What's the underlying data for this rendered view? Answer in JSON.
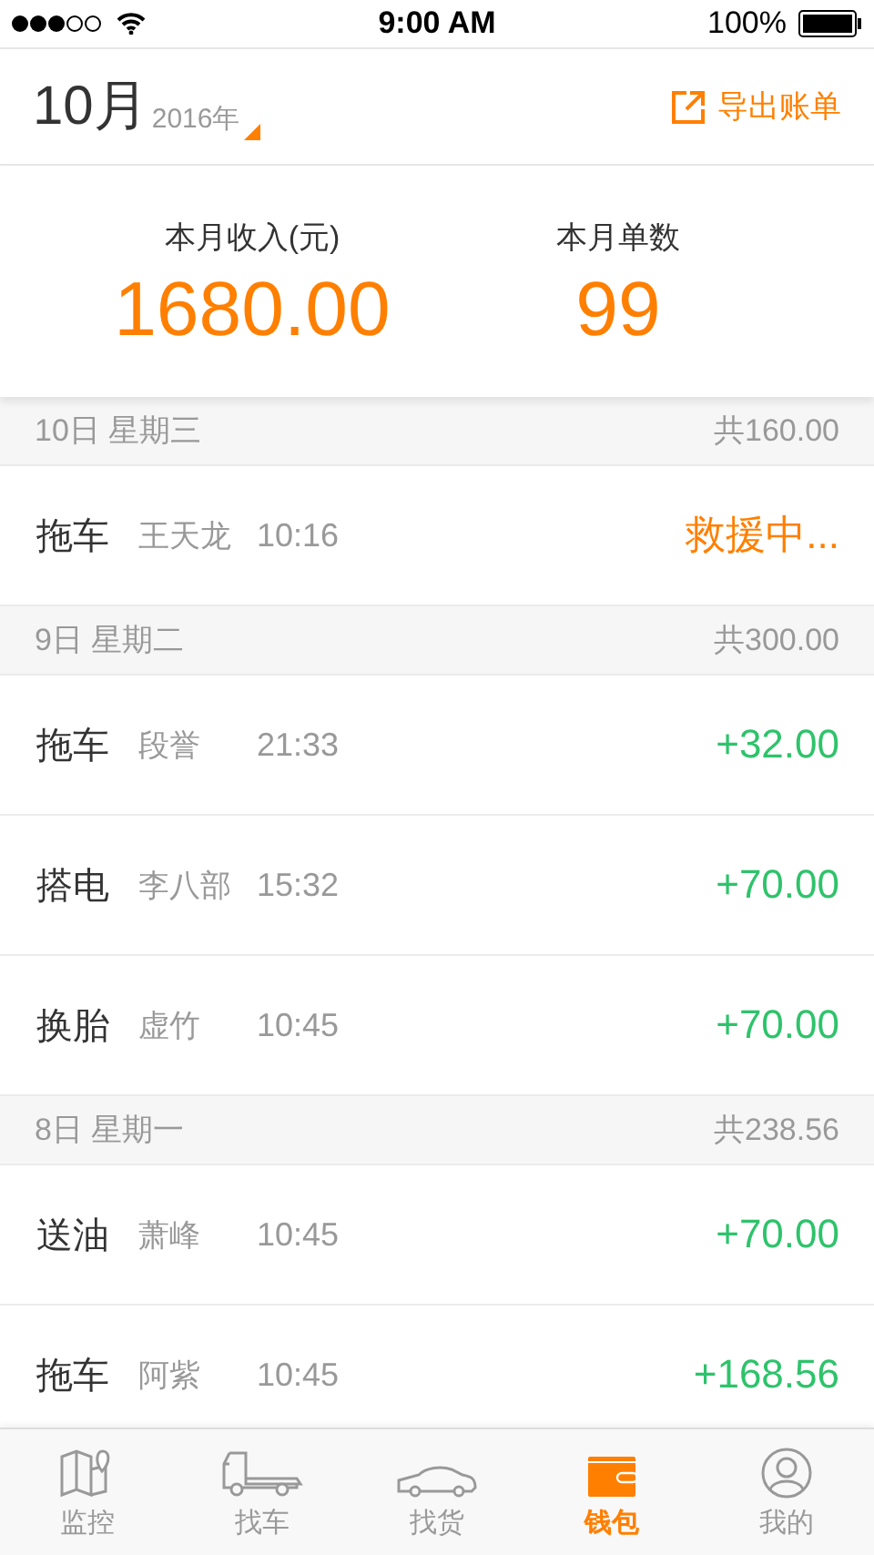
{
  "status_bar": {
    "time": "9:00 AM",
    "battery": "100%"
  },
  "header": {
    "month": "10月",
    "year": "2016年",
    "export": "导出账单"
  },
  "summary": [
    {
      "label": "本月收入(元)",
      "value": "1680.00"
    },
    {
      "label": "本月单数",
      "value": "99"
    }
  ],
  "days": [
    {
      "date": "10日 星期三",
      "total": "共160.00",
      "orders": [
        {
          "service": "拖车",
          "customer": "王天龙",
          "time": "10:16",
          "amount": "救援中...",
          "kind": "pending"
        }
      ]
    },
    {
      "date": "9日 星期二",
      "total": "共300.00",
      "orders": [
        {
          "service": "拖车",
          "customer": "段誉",
          "time": "21:33",
          "amount": "+32.00",
          "kind": "income"
        },
        {
          "service": "搭电",
          "customer": "李八部",
          "time": "15:32",
          "amount": "+70.00",
          "kind": "income"
        },
        {
          "service": "换胎",
          "customer": "虚竹",
          "time": "10:45",
          "amount": "+70.00",
          "kind": "income"
        }
      ]
    },
    {
      "date": "8日 星期一",
      "total": "共238.56",
      "orders": [
        {
          "service": "送油",
          "customer": "萧峰",
          "time": "10:45",
          "amount": "+70.00",
          "kind": "income"
        },
        {
          "service": "拖车",
          "customer": "阿紫",
          "time": "10:45",
          "amount": "+168.56",
          "kind": "income"
        }
      ]
    }
  ],
  "tabs": [
    {
      "label": "监控",
      "kind": "map",
      "selected": false
    },
    {
      "label": "找车",
      "kind": "truck",
      "selected": false
    },
    {
      "label": "找货",
      "kind": "car",
      "selected": false
    },
    {
      "label": "钱包",
      "kind": "wallet",
      "selected": true
    },
    {
      "label": "我的",
      "kind": "user",
      "selected": false
    }
  ]
}
